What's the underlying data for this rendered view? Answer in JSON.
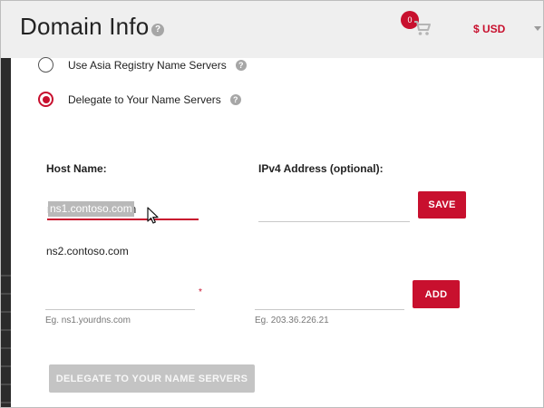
{
  "header": {
    "title": "Domain Info",
    "title_help_icon": "?",
    "cart_count": "0",
    "currency": "$ USD"
  },
  "options": {
    "asia_registry_label": "Use Asia Registry Name Servers",
    "delegate_label": "Delegate to Your Name Servers",
    "help_icon": "?"
  },
  "form": {
    "host_name_label": "Host Name:",
    "ipv4_label": "IPv4 Address (optional):",
    "host1_value": "ns1.contoso.com",
    "ip1_value": "",
    "save_label": "SAVE",
    "host2_static": "ns2.contoso.com",
    "host_new_value": "",
    "required_mark": "*",
    "ip_new_value": "",
    "add_label": "ADD",
    "host_hint": "Eg. ns1.yourdns.com",
    "ip_hint": "Eg. 203.36.226.21",
    "delegate_button_label": "DELEGATE TO YOUR NAME SERVERS"
  },
  "colors": {
    "accent": "#c8102e",
    "disabled": "#c4c4c4"
  },
  "icons": [
    "help-icon",
    "cart-icon",
    "chevron-down-icon",
    "mouse-cursor-icon"
  ]
}
